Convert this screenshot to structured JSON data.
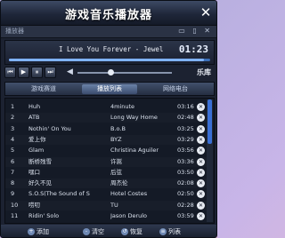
{
  "window": {
    "title": "游戏音乐播放器",
    "close_glyph": "✕"
  },
  "subbar": {
    "label": "播放器",
    "icons": "▭ ▯ ✕"
  },
  "display": {
    "now_playing": "I Love You Forever - Jewel",
    "time": "01:23",
    "progress": 0.97
  },
  "controls": {
    "prev": "⏮",
    "play": "▶",
    "pause": "⏸",
    "next": "⏭",
    "volume_icon": "◀",
    "volume_level": 0.35,
    "library_label": "乐库"
  },
  "tabs": [
    {
      "label": "游戏赛道"
    },
    {
      "label": "播放列表"
    },
    {
      "label": "网络电台"
    }
  ],
  "playlist": [
    {
      "num": "1",
      "title": "Huh",
      "artist": "4minute",
      "duration": "03:16"
    },
    {
      "num": "2",
      "title": "ATB",
      "artist": "Long Way Home",
      "duration": "02:48"
    },
    {
      "num": "3",
      "title": "Nothin' On You",
      "artist": "B.o.B",
      "duration": "03:25"
    },
    {
      "num": "4",
      "title": "爱上你",
      "artist": "BYZ",
      "duration": "03:29"
    },
    {
      "num": "5",
      "title": "Glam",
      "artist": "Christina Aguiler",
      "duration": "03:56"
    },
    {
      "num": "6",
      "title": "断桥残雪",
      "artist": "许嵩",
      "duration": "03:36"
    },
    {
      "num": "7",
      "title": "嘿口",
      "artist": "后弦",
      "duration": "03:50"
    },
    {
      "num": "8",
      "title": "好久不见",
      "artist": "周杰伦",
      "duration": "02:08"
    },
    {
      "num": "9",
      "title": "S.O.S(The Sound of S",
      "artist": "Hotel Costes",
      "duration": "02:50"
    },
    {
      "num": "10",
      "title": "唠叨",
      "artist": "TU",
      "duration": "02:28"
    },
    {
      "num": "11",
      "title": "Ridin' Solo",
      "artist": "Jason Derulo",
      "duration": "03:59"
    }
  ],
  "bottom": [
    {
      "label": "添加",
      "icon": "+"
    },
    {
      "label": "清空",
      "icon": "-"
    },
    {
      "label": "恢复",
      "icon": "↺"
    },
    {
      "label": "列表",
      "icon": "≡"
    }
  ]
}
